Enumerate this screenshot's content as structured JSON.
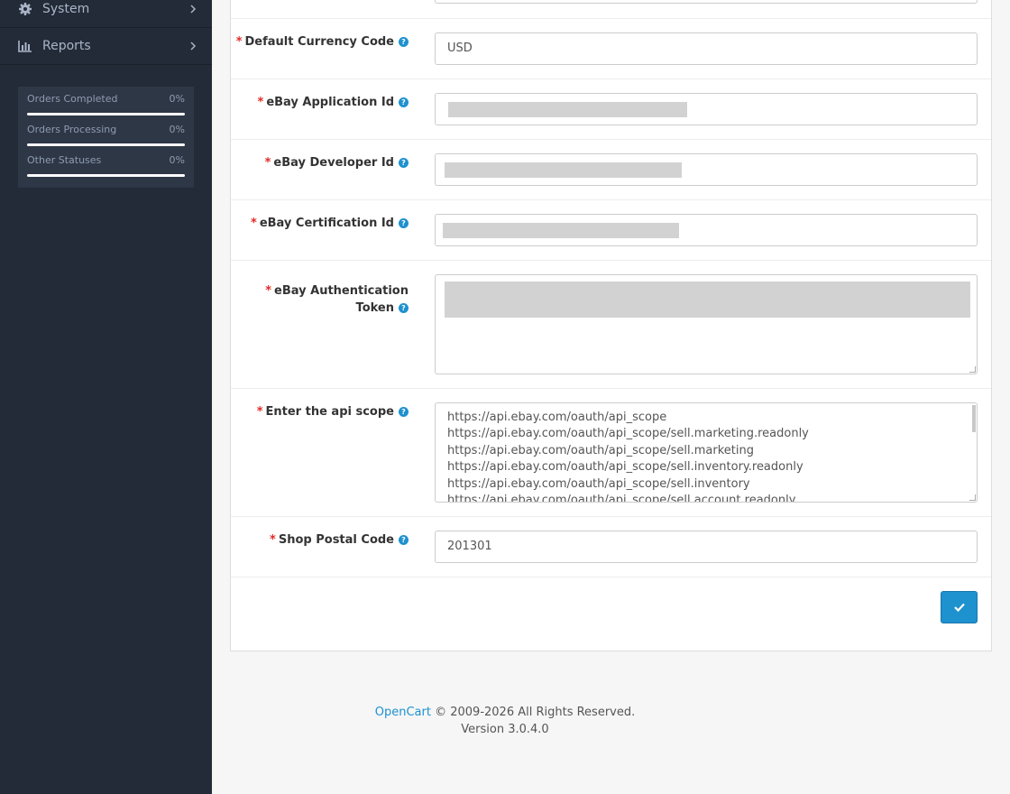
{
  "sidebar": {
    "nav": [
      {
        "label": "System",
        "icon": "gear-icon"
      },
      {
        "label": "Reports",
        "icon": "bar-chart-icon"
      }
    ],
    "stats": [
      {
        "label": "Orders Completed",
        "value": "0%",
        "progress": 0
      },
      {
        "label": "Orders Processing",
        "value": "0%",
        "progress": 0
      },
      {
        "label": "Other Statuses",
        "value": "0%",
        "progress": 0
      }
    ]
  },
  "form": {
    "currency": {
      "label": "Default Currency Code",
      "value": "USD"
    },
    "app_id": {
      "label": "eBay Application Id"
    },
    "dev_id": {
      "label": "eBay Developer Id"
    },
    "cert_id": {
      "label": "eBay Certification Id"
    },
    "token": {
      "label": "eBay Authentication Token"
    },
    "scope": {
      "label": "Enter the api scope",
      "lines": [
        "https://api.ebay.com/oauth/api_scope",
        "https://api.ebay.com/oauth/api_scope/sell.marketing.readonly",
        "https://api.ebay.com/oauth/api_scope/sell.marketing",
        "https://api.ebay.com/oauth/api_scope/sell.inventory.readonly",
        "https://api.ebay.com/oauth/api_scope/sell.inventory",
        "https://api.ebay.com/oauth/api_scope/sell.account.readonly"
      ]
    },
    "postal": {
      "label": "Shop Postal Code",
      "value": "201301"
    },
    "required_mark": "*",
    "help_glyph": "?"
  },
  "footer": {
    "brand": "OpenCart",
    "copyright": " © 2009-2026 All Rights Reserved.",
    "version": "Version 3.0.4.0"
  },
  "colors": {
    "accent": "#1e91cf",
    "sidebar": "#232b38",
    "required": "#e02b27"
  }
}
